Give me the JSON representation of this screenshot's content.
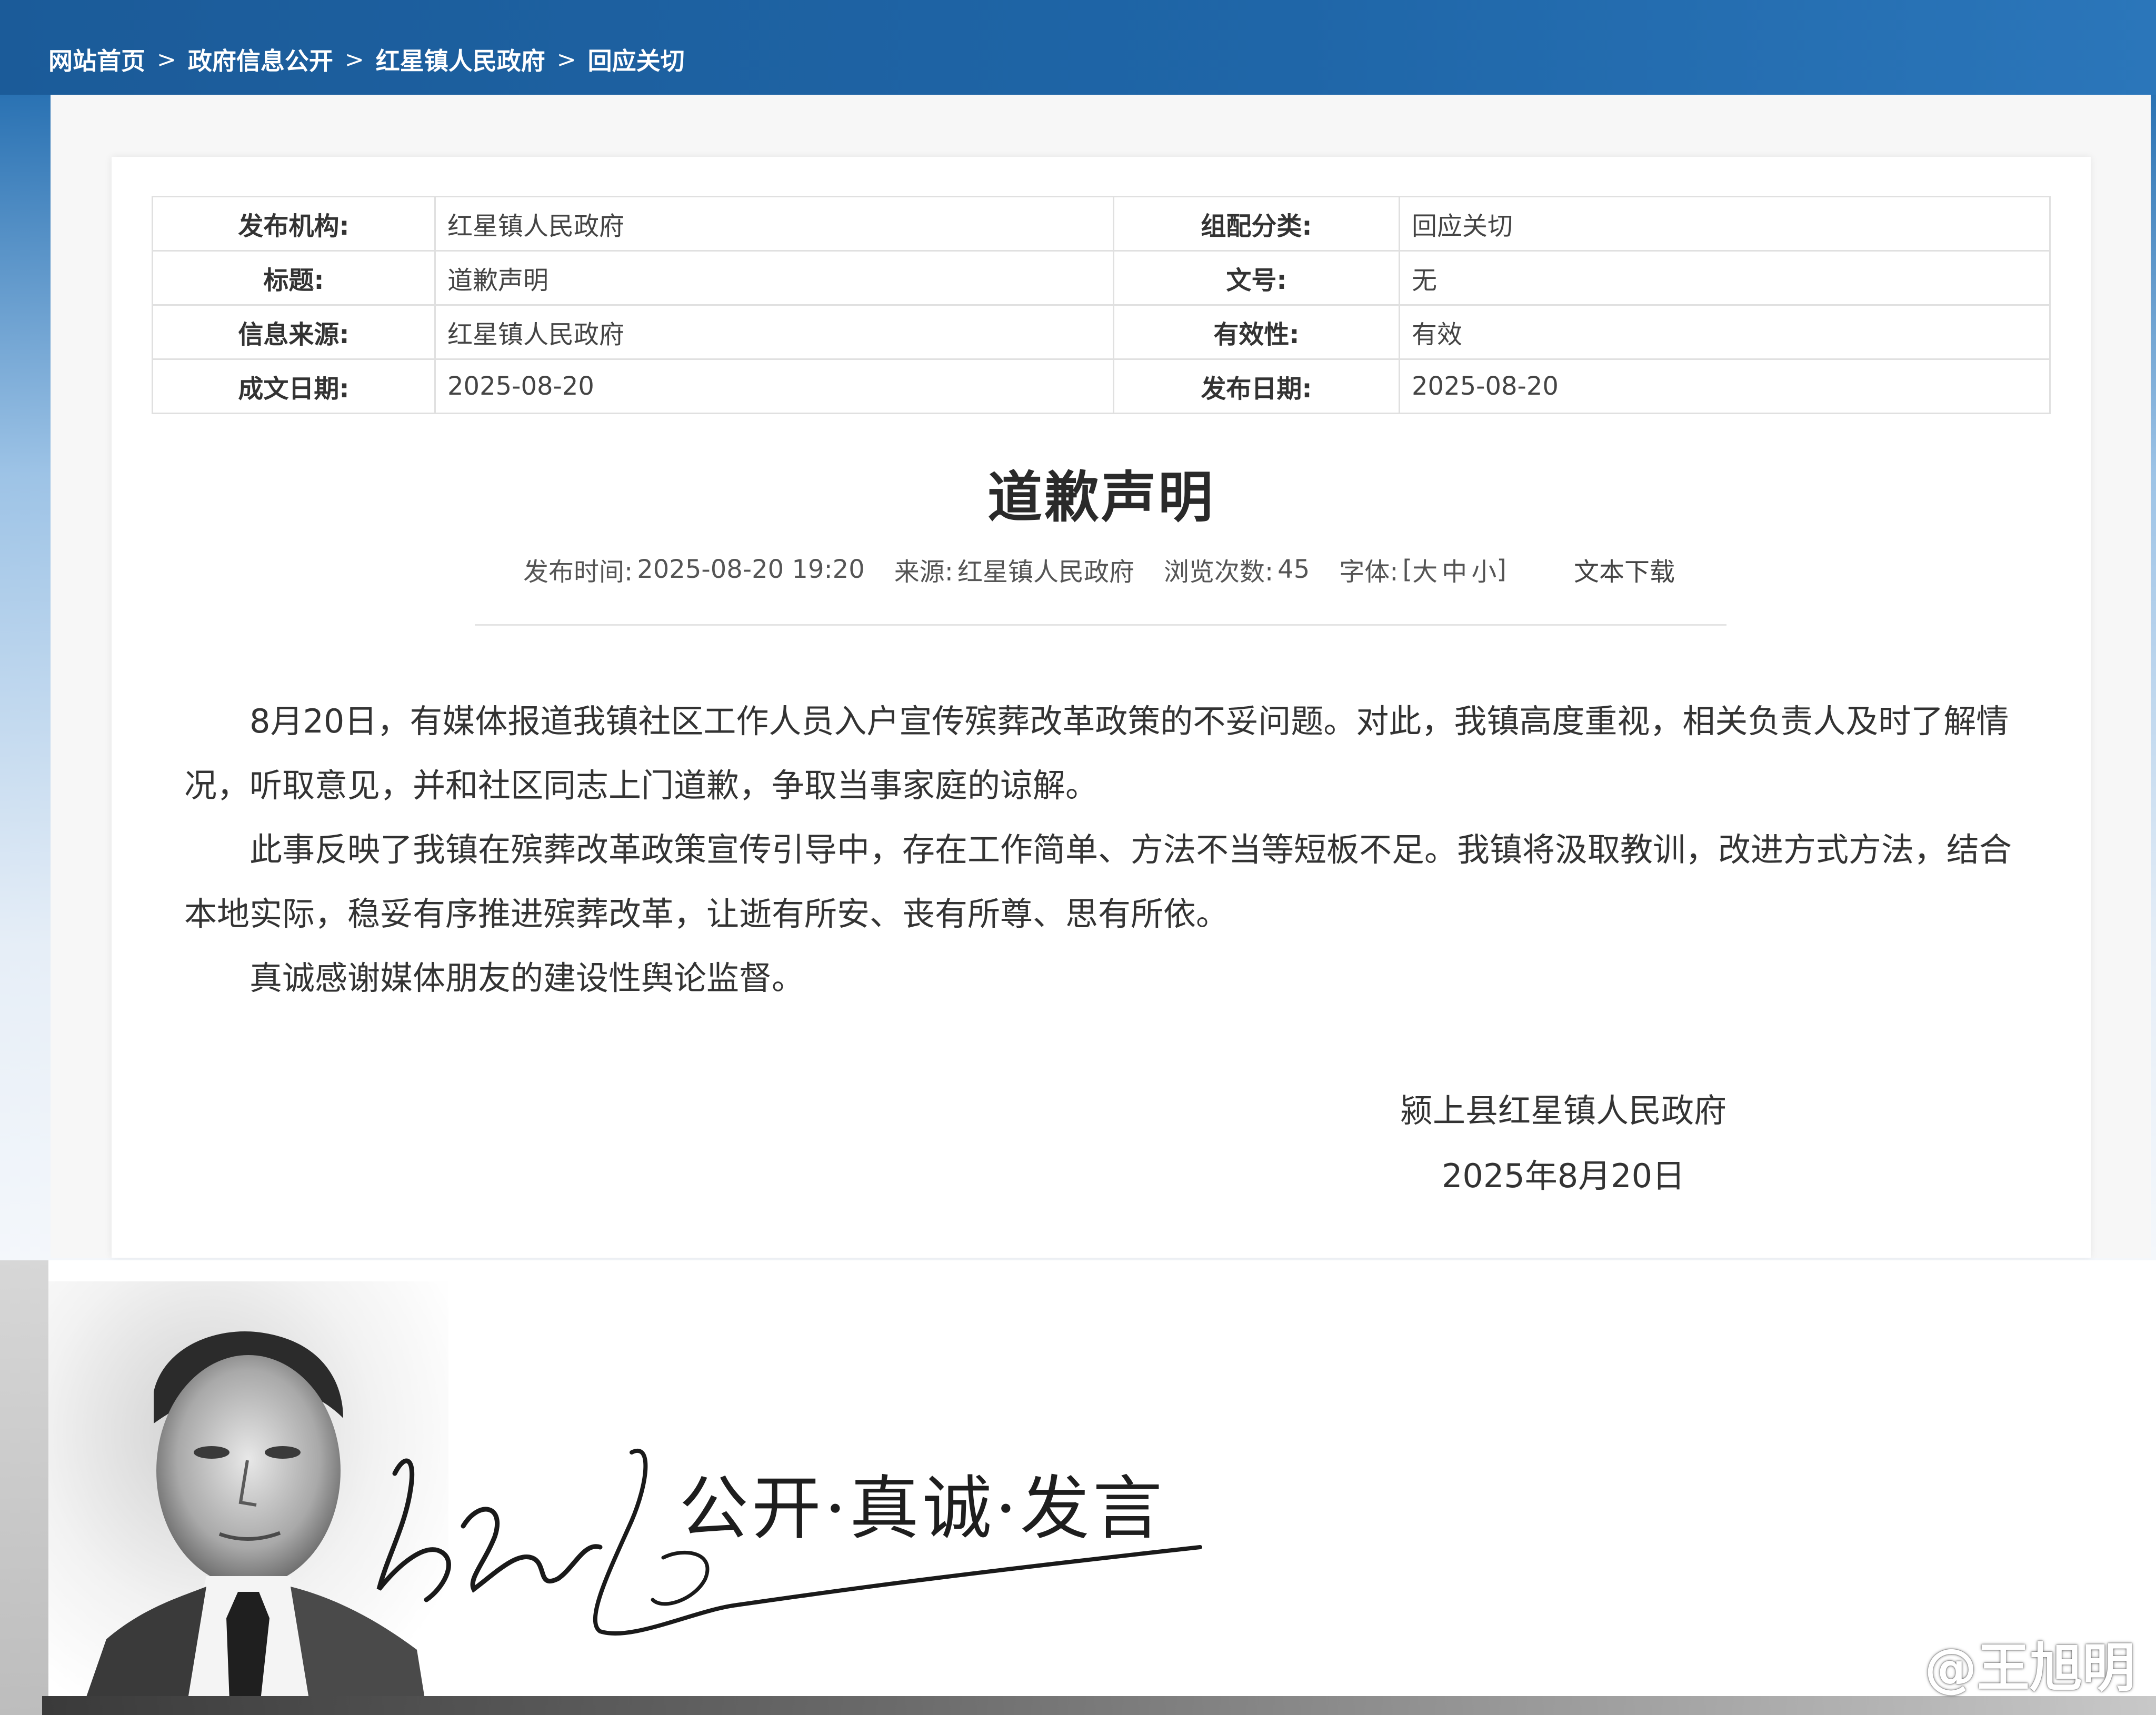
{
  "breadcrumb": {
    "items": [
      "网站首页",
      "政府信息公开",
      "红星镇人民政府",
      "回应关切"
    ],
    "separator": ">"
  },
  "meta": {
    "publisher_label": "发布机构:",
    "publisher": "红星镇人民政府",
    "category_label": "组配分类:",
    "category": "回应关切",
    "title_label": "标题:",
    "title": "道歉声明",
    "doc_no_label": "文号:",
    "doc_no": "无",
    "source_label": "信息来源:",
    "source": "红星镇人民政府",
    "validity_label": "有效性:",
    "validity": "有效",
    "written_date_label": "成文日期:",
    "written_date": "2025-08-20",
    "publish_date_label": "发布日期:",
    "publish_date": "2025-08-20"
  },
  "article": {
    "title": "道歉声明",
    "publish_time_label": "发布时间:",
    "publish_time": "2025-08-20 19:20",
    "source_label": "来源:",
    "source": "红星镇人民政府",
    "views_label": "浏览次数:",
    "views": "45",
    "font_label": "字体:",
    "font_open": "[",
    "font_large": "大",
    "font_medium": "中",
    "font_small": "小",
    "font_close": "]",
    "download_label": "文本下载",
    "paragraphs": [
      "8月20日，有媒体报道我镇社区工作人员入户宣传殡葬改革政策的不妥问题。对此，我镇高度重视，相关负责人及时了解情况，听取意见，并和社区同志上门道歉，争取当事家庭的谅解。",
      "此事反映了我镇在殡葬改革政策宣传引导中，存在工作简单、方法不当等短板不足。我镇将汲取教训，改进方式方法，结合本地实际，稳妥有序推进殡葬改革，让逝有所安、丧有所尊、思有所依。",
      "真诚感谢媒体朋友的建设性舆论监督。"
    ],
    "signature_org": "颍上县红星镇人民政府",
    "signature_date": "2025年8月20日"
  },
  "banner": {
    "slogan": "公开·真诚·发言",
    "watermark": "@王旭明",
    "signature_icon": "handwritten-signature",
    "portrait_icon": "author-portrait"
  },
  "colors": {
    "topbar": "#1f66a8",
    "breadcrumb_text": "#ffffff",
    "table_border": "#e0e0e0",
    "body_text": "#333333"
  }
}
